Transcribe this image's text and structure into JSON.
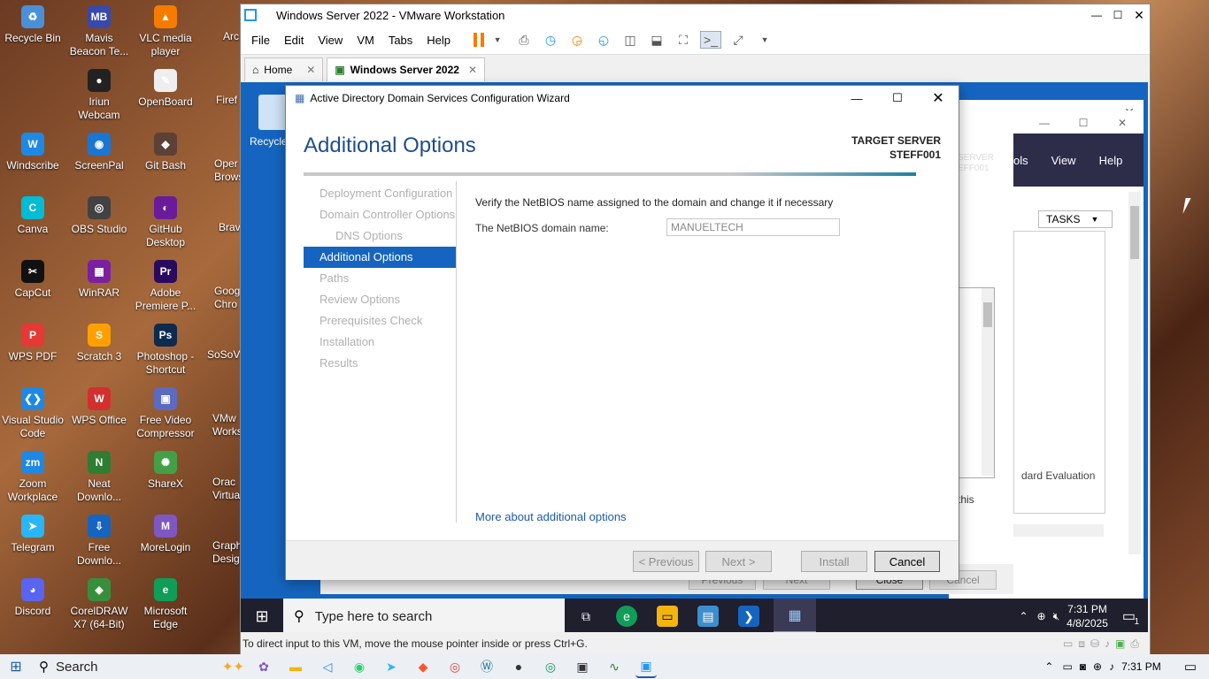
{
  "desktop": {
    "icons": [
      {
        "label": "Recycle Bin",
        "glyph": "♻",
        "color": "#4a90d9"
      },
      {
        "label": "Mavis Beacon Te...",
        "glyph": "MB",
        "color": "#3949ab"
      },
      {
        "label": "VLC media player",
        "glyph": "▲",
        "color": "#f57c00"
      },
      {
        "label": "Iriun Webcam",
        "glyph": "●",
        "color": "#222222"
      },
      {
        "label": "OpenBoard",
        "glyph": "✎",
        "color": "#eeeeee"
      },
      {
        "label": "Windscribe",
        "glyph": "W",
        "color": "#1e88e5"
      },
      {
        "label": "ScreenPal",
        "glyph": "◉",
        "color": "#1976d2"
      },
      {
        "label": "Git Bash",
        "glyph": "◆",
        "color": "#5d4037"
      },
      {
        "label": "Canva",
        "glyph": "C",
        "color": "#00bcd4"
      },
      {
        "label": "OBS Studio",
        "glyph": "◎",
        "color": "#424242"
      },
      {
        "label": "GitHub Desktop",
        "glyph": "◐",
        "color": "#6a1b9a"
      },
      {
        "label": "CapCut",
        "glyph": "✂",
        "color": "#111111"
      },
      {
        "label": "WinRAR",
        "glyph": "▦",
        "color": "#7b1fa2"
      },
      {
        "label": "Adobe Premiere P...",
        "glyph": "Pr",
        "color": "#2a0a5e"
      },
      {
        "label": "WPS PDF",
        "glyph": "P",
        "color": "#e53935"
      },
      {
        "label": "Scratch 3",
        "glyph": "S",
        "color": "#ffa000"
      },
      {
        "label": "Photoshop - Shortcut",
        "glyph": "Ps",
        "color": "#0d2b4f"
      },
      {
        "label": "Visual Studio Code",
        "glyph": "❮❯",
        "color": "#1e88e5"
      },
      {
        "label": "WPS Office",
        "glyph": "W",
        "color": "#d32f2f"
      },
      {
        "label": "Free Video Compressor",
        "glyph": "▣",
        "color": "#5c6bc0"
      },
      {
        "label": "Zoom Workplace",
        "glyph": "zm",
        "color": "#1e88e5"
      },
      {
        "label": "Neat Downlo...",
        "glyph": "N",
        "color": "#2e7d32"
      },
      {
        "label": "ShareX",
        "glyph": "✺",
        "color": "#43a047"
      },
      {
        "label": "Telegram",
        "glyph": "➤",
        "color": "#29b6f6"
      },
      {
        "label": "Free Downlo...",
        "glyph": "⇩",
        "color": "#1565c0"
      },
      {
        "label": "MoreLogin",
        "glyph": "M",
        "color": "#7e57c2"
      },
      {
        "label": "Discord",
        "glyph": "◕",
        "color": "#5865f2"
      },
      {
        "label": "CorelDRAW X7 (64-Bit)",
        "glyph": "◈",
        "color": "#388e3c"
      },
      {
        "label": "Microsoft Edge",
        "glyph": "e",
        "color": "#0f9d58"
      }
    ],
    "partial_labels": [
      "Arc",
      "Firef",
      "Oper Brows",
      "Brav",
      "Goog Chro",
      "SoSoV",
      "VMw Works",
      "Orac Virtual",
      "Graph Desig"
    ]
  },
  "vmware": {
    "title": "Windows Server 2022 - VMware Workstation",
    "menu": [
      "File",
      "Edit",
      "View",
      "VM",
      "Tabs",
      "Help"
    ],
    "tabs": [
      {
        "label": "Home"
      },
      {
        "label": "Windows Server 2022"
      }
    ],
    "status": "To direct input to this VM, move the mouse pointer inside or press Ctrl+G."
  },
  "guest": {
    "recycle_label": "Recycle",
    "server_manager": {
      "menu": [
        "ols",
        "View",
        "Help"
      ],
      "tasks": "TASKS",
      "target_server_frag": [
        "SERVER",
        "EFF001"
      ],
      "eval_text": "dard Evaluation",
      "this_text": "this"
    },
    "bg_buttons": [
      "Previous",
      "Next",
      "Close",
      "Cancel"
    ],
    "taskbar": {
      "search_placeholder": "Type here to search",
      "time": "7:31 PM",
      "date": "4/8/2025",
      "notif_count": "1"
    }
  },
  "wizard": {
    "title": "Active Directory Domain Services Configuration Wizard",
    "heading": "Additional Options",
    "target_label": "TARGET SERVER",
    "target_value": "STEFF001",
    "nav": [
      {
        "label": "Deployment Configuration",
        "active": false,
        "indent": false
      },
      {
        "label": "Domain Controller Options",
        "active": false,
        "indent": false
      },
      {
        "label": "DNS Options",
        "active": false,
        "indent": true
      },
      {
        "label": "Additional Options",
        "active": true,
        "indent": false
      },
      {
        "label": "Paths",
        "active": false,
        "indent": false
      },
      {
        "label": "Review Options",
        "active": false,
        "indent": false
      },
      {
        "label": "Prerequisites Check",
        "active": false,
        "indent": false
      },
      {
        "label": "Installation",
        "active": false,
        "indent": false
      },
      {
        "label": "Results",
        "active": false,
        "indent": false
      }
    ],
    "instruction": "Verify the NetBIOS name assigned to the domain and change it if necessary",
    "netbios_label": "The NetBIOS domain name:",
    "netbios_value": "MANUELTECH",
    "more_link": "More about additional options",
    "buttons": {
      "previous": "< Previous",
      "next": "Next >",
      "install": "Install",
      "cancel": "Cancel"
    }
  },
  "host_taskbar": {
    "search": "Search",
    "time": "7:31 PM"
  }
}
